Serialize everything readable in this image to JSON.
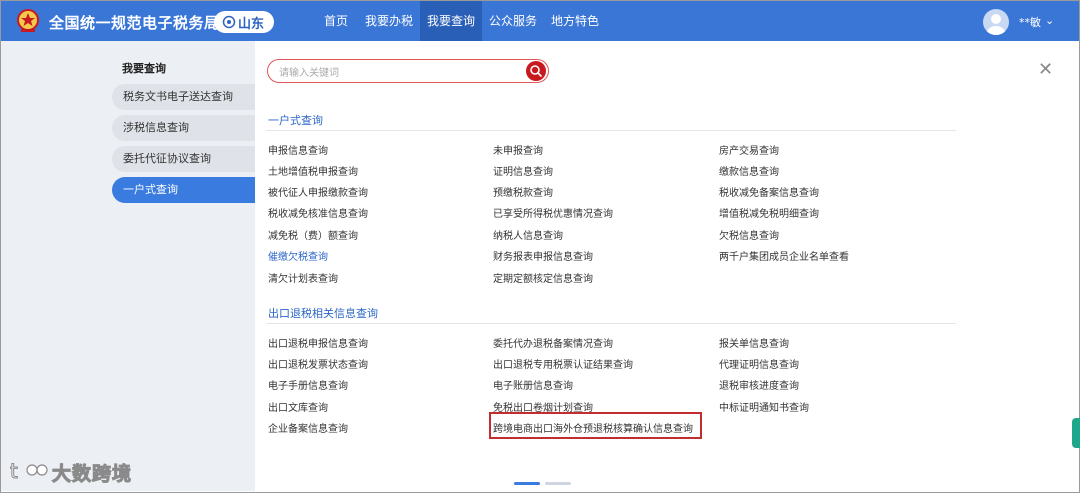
{
  "header": {
    "site_title": "全国统一规范电子税务局",
    "region": "山东",
    "nav": [
      "首页",
      "我要办税",
      "我要查询",
      "公众服务",
      "地方特色"
    ],
    "active_nav": "我要查询",
    "username": "**敏",
    "colors": {
      "bar": "#3a76d6",
      "active": "#2a5fb8"
    }
  },
  "sidebar": {
    "title": "我要查询",
    "items": [
      "税务文书电子送达查询",
      "涉税信息查询",
      "委托代征协议查询",
      "一户式查询"
    ],
    "active": "一户式查询"
  },
  "search": {
    "placeholder": "请输入关键词"
  },
  "sections": [
    {
      "title": "一户式查询",
      "links": [
        "申报信息查询",
        "未申报查询",
        "房产交易查询",
        "土地增值税申报查询",
        "证明信息查询",
        "缴款信息查询",
        "被代征人申报缴款查询",
        "预缴税款查询",
        "税收减免备案信息查询",
        "税收减免核准信息查询",
        "已享受所得税优惠情况查询",
        "增值税减免税明细查询",
        "减免税（费）额查询",
        "纳税人信息查询",
        "欠税信息查询",
        "催缴欠税查询",
        "财务报表申报信息查询",
        "两千户集团成员企业名单查看",
        "清欠计划表查询",
        "定期定额核定信息查询"
      ]
    },
    {
      "title": "出口退税相关信息查询",
      "links": [
        "出口退税申报信息查询",
        "委托代办退税备案情况查询",
        "报关单信息查询",
        "出口退税发票状态查询",
        "出口退税专用税票认证结果查询",
        "代理证明信息查询",
        "电子手册信息查询",
        "电子账册信息查询",
        "退税审核进度查询",
        "出口文库查询",
        "免税出口卷烟计划查询",
        "中标证明通知书查询",
        "企业备案信息查询",
        "跨境电商出口海外仓预退税核算确认信息查询"
      ]
    }
  ],
  "highlighted_link": "跨境电商出口海外仓预退税核算确认信息查询",
  "watermark": "大数跨境"
}
